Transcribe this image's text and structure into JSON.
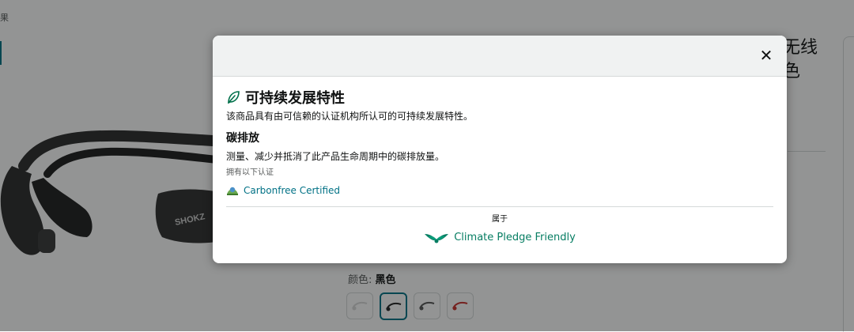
{
  "background": {
    "breadcrumb": "果",
    "title_line1": "无线",
    "title_line2": "色",
    "color_label": "颜色:",
    "color_value": "黑色",
    "brand_text": "SHOKZ"
  },
  "modal": {
    "close_symbol": "✕",
    "heading": "可持续发展特性",
    "description": "该商品具有由可信赖的认证机构所认可的可持续发展特性。",
    "section_title": "碳排放",
    "section_description": "测量、减少并抵消了此产品生命周期中的碳排放量。",
    "certifications_label": "拥有以下认证",
    "certification": "Carbonfree Certified",
    "belongs_label": "属于",
    "program": "Climate Pledge Friendly"
  },
  "colors": {
    "accent": "#007185",
    "pledge_green": "#067d62",
    "leaf_green": "#00704a"
  },
  "icons": {
    "heading_icon": "leaf-icon",
    "certification_icon": "carbonfree-badge-icon",
    "program_icon": "climate-pledge-wings-icon",
    "close_icon": "close-icon"
  }
}
